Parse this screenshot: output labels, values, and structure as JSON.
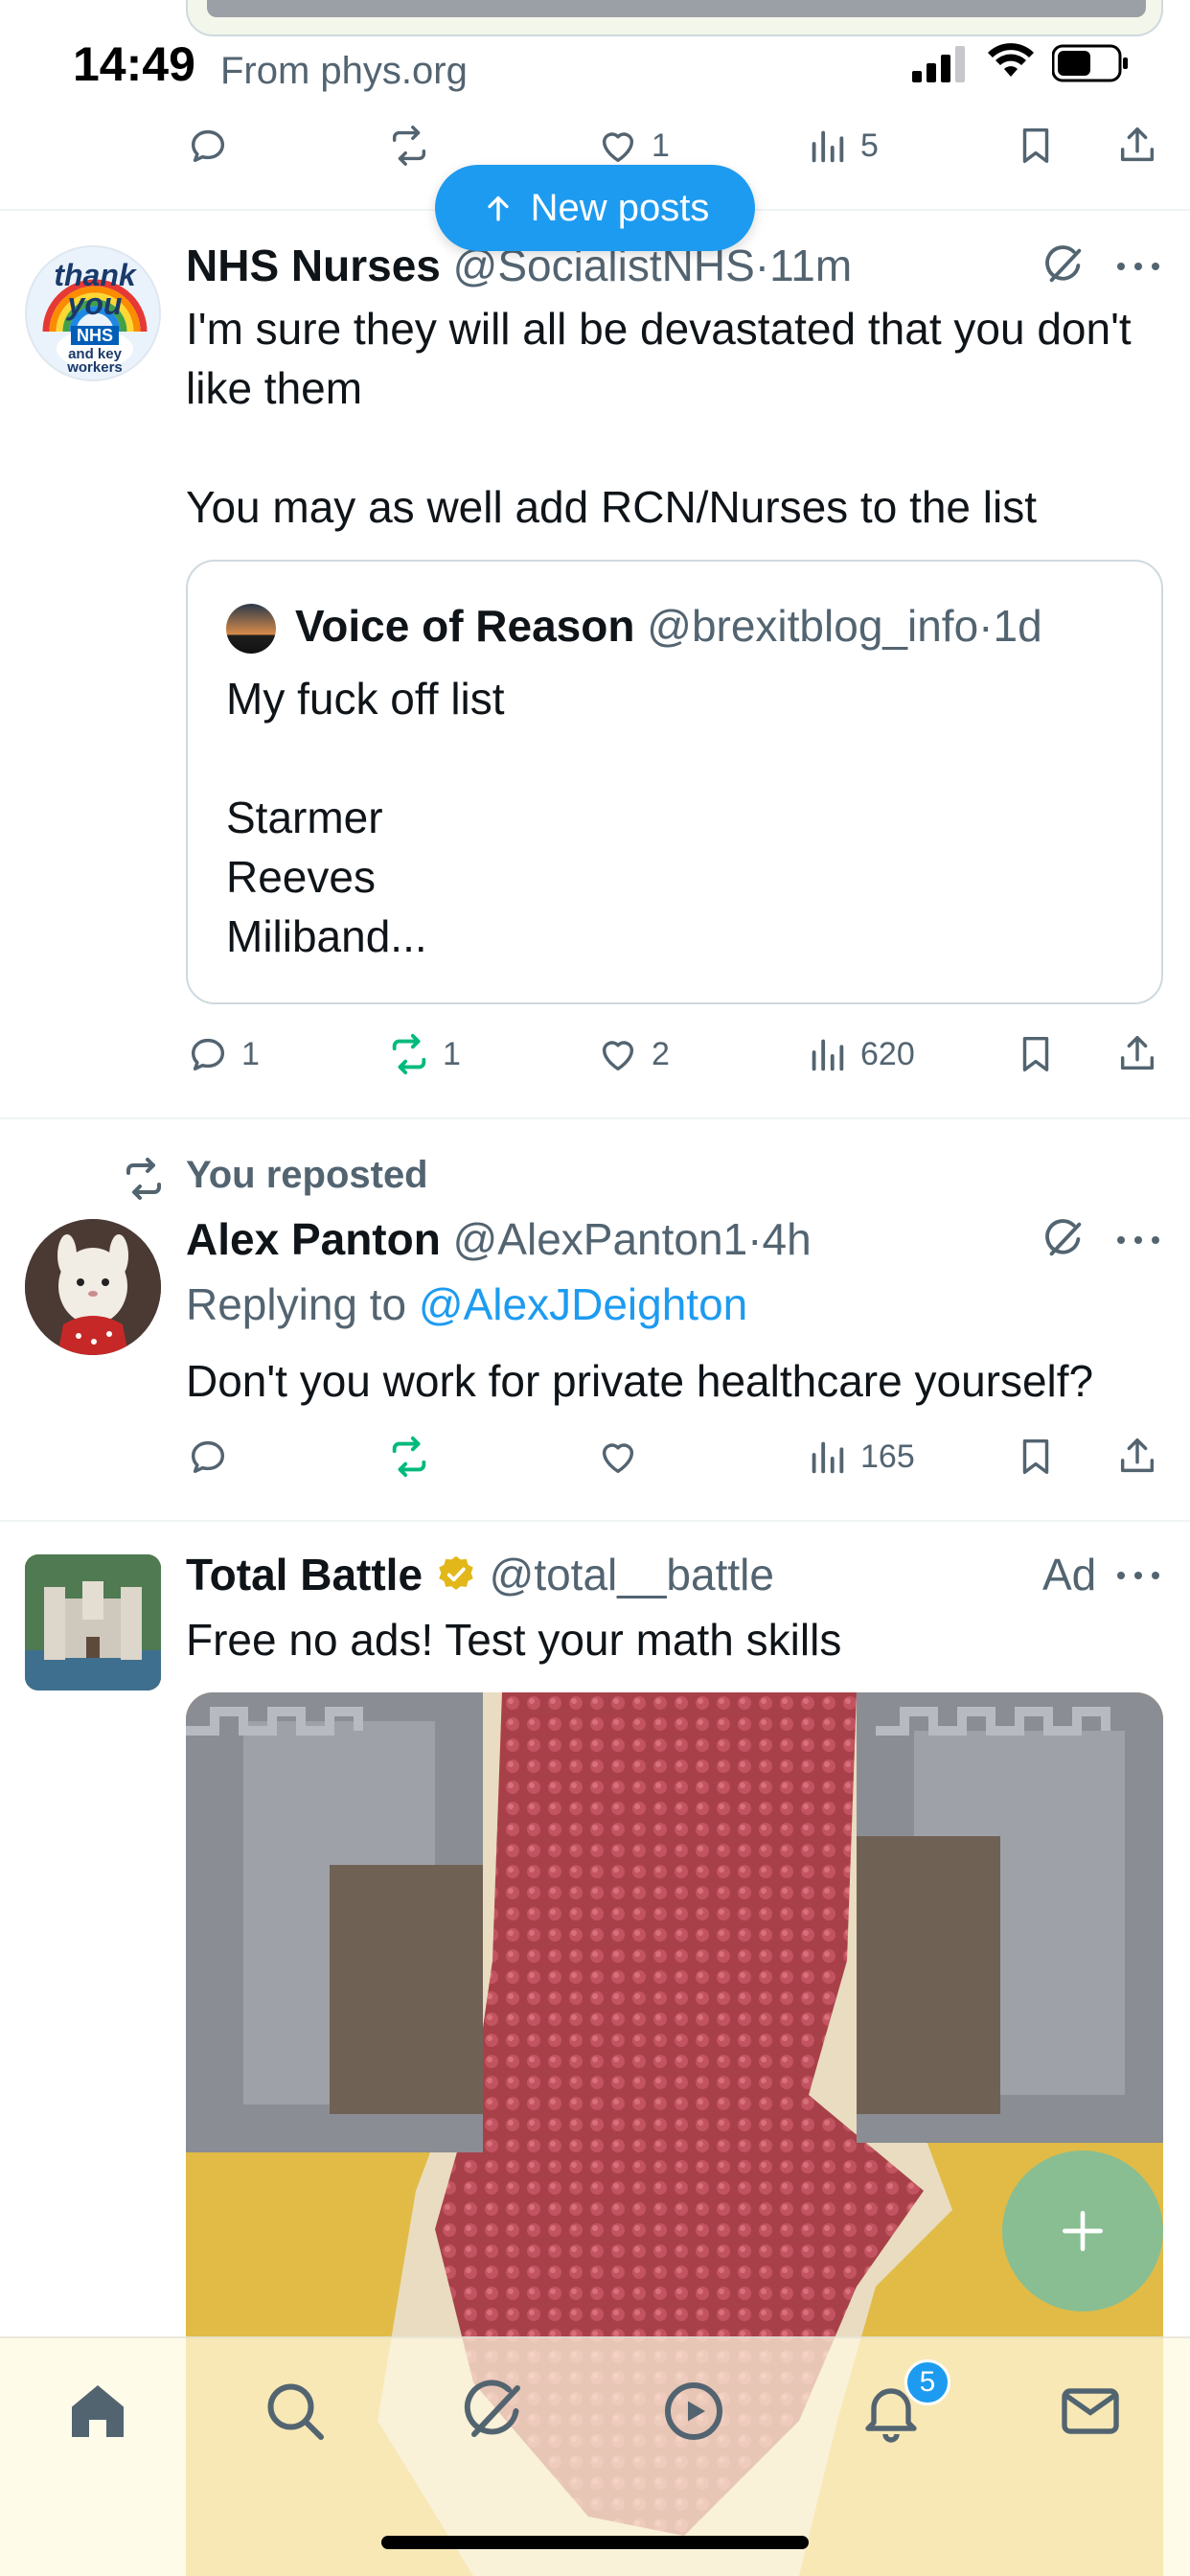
{
  "status_bar": {
    "time": "14:49",
    "source": "From phys.org"
  },
  "prev_post": {
    "reply_count": "",
    "repost_count": "",
    "like_count": "1",
    "view_count": "5"
  },
  "new_posts_button": {
    "label": "New posts"
  },
  "post1": {
    "name": "NHS Nurses",
    "handle": "@SocialistNHS",
    "dot": "·",
    "time": "11m",
    "text": "I'm sure they will all be devastated that you don't like them\n\nYou may as well add RCN/Nurses to the list",
    "avatar_text": [
      "thank",
      "you",
      "NHS",
      "and key",
      "workers"
    ],
    "quote": {
      "name": "Voice of Reason",
      "handle": "@brexitblog_info",
      "dot": "·",
      "time": "1d",
      "text": "My fuck off list\n\nStarmer\nReeves\nMiliband..."
    },
    "reply_count": "1",
    "repost_count": "1",
    "like_count": "2",
    "view_count": "620"
  },
  "post2": {
    "repost_label": "You reposted",
    "name": "Alex Panton",
    "handle": "@AlexPanton1",
    "dot": "·",
    "time": "4h",
    "replying_prefix": "Replying to",
    "replying_to": "@AlexJDeighton",
    "text": "Don't you work for private healthcare yourself?",
    "view_count": "165"
  },
  "post3": {
    "name": "Total Battle",
    "handle": "@total__battle",
    "ad_label": "Ad",
    "text": "Free no ads! Test your math skills"
  },
  "tab_bar": {
    "notification_badge": "5"
  },
  "colors": {
    "accent": "#1d9bf0",
    "repost_active": "#00ba7c",
    "text_primary": "#0f1419",
    "text_secondary": "#536471"
  },
  "icons": [
    "list-icon",
    "signal-icon",
    "wifi-icon",
    "battery-icon",
    "reply-icon",
    "repost-icon",
    "like-icon",
    "views-icon",
    "bookmark-icon",
    "share-icon",
    "grok-icon",
    "more-icon",
    "verified-icon",
    "plus-icon",
    "home-icon",
    "search-icon",
    "grok-tab-icon",
    "video-icon",
    "bell-icon",
    "mail-icon"
  ]
}
